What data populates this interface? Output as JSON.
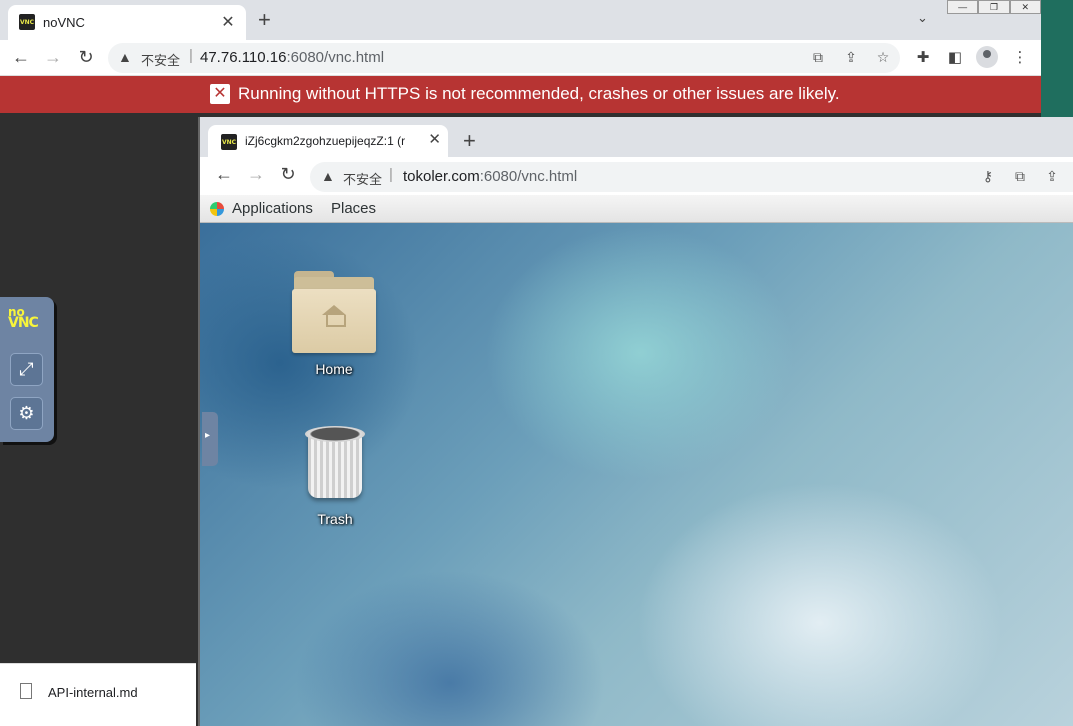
{
  "outer_browser": {
    "tab_title": "noVNC",
    "url_insecure_label": "不安全",
    "url_host": "47.76.110.16",
    "url_rest": ":6080/vnc.html",
    "banner_message": "Running without HTTPS is not recommended, crashes or other issues are likely.",
    "window_controls": [
      "—",
      "❐",
      "✕"
    ]
  },
  "novnc_bar": {
    "logo_no": "no",
    "logo_vnc": "VNC"
  },
  "download": {
    "file_name": "API-internal.md"
  },
  "inner_browser": {
    "tab_title": "iZj6cgkm2zgohzuepijeqzZ:1 (r",
    "url_insecure_label": "不安全",
    "url_host": "tokoler.com",
    "url_rest": ":6080/vnc.html"
  },
  "gnome_panel": {
    "menu_items": [
      "Applications",
      "Places"
    ]
  },
  "desktop": {
    "icons": [
      "Home",
      "Trash"
    ]
  },
  "colors": {
    "banner_bg": "#b73433",
    "novnc_bar": "#6e84a3",
    "logo": "#f8f53a"
  }
}
